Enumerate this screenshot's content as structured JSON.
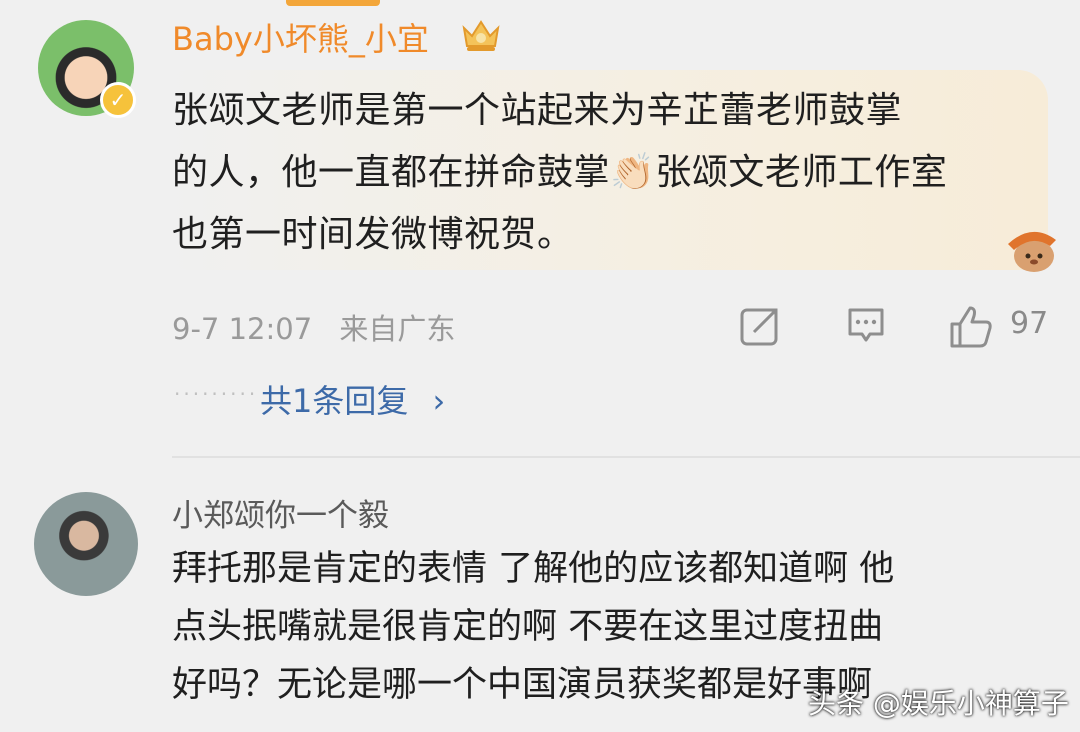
{
  "comment1": {
    "username": "Baby小坏熊_小宜",
    "text": "张颂文老师是第一个站起来为辛芷蕾老师鼓掌\n的人，他一直都在拼命鼓掌👏🏻张颂文老师工作室\n也第一时间发微博祝贺。",
    "timestamp": "9-7 12:07",
    "location": "来自广东",
    "likes": "97",
    "replies_label": "共1条回复"
  },
  "comment2": {
    "username": "小郑颂你一个毅",
    "text": "拜托那是肯定的表情 了解他的应该都知道啊 他\n点头抿嘴就是很肯定的啊  不要在这里过度扭曲\n好吗？无论是哪一个中国演员获奖都是好事啊"
  },
  "watermark": "头条 @娱乐小神算子",
  "icons": [
    "verified-icon",
    "crown-badge-icon",
    "share-icon",
    "comment-icon",
    "like-icon",
    "chevron-right-icon",
    "mascot-sticker"
  ],
  "colors": {
    "username_vip": "#f08a2a",
    "link": "#3d6aa8",
    "meta": "#9a9a9a"
  }
}
